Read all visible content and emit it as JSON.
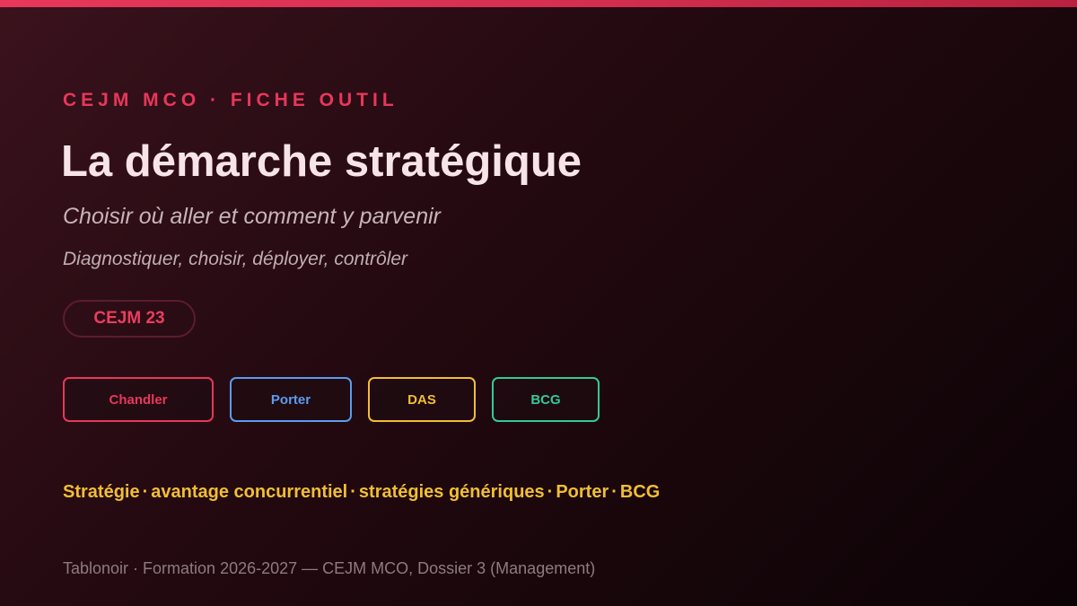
{
  "kicker": "CEJM MCO · FICHE OUTIL",
  "title": "La démarche stratégique",
  "subtitle": "Choisir où aller et comment y parvenir",
  "tagline": "Diagnostiquer, choisir, déployer, contrôler",
  "badge": "CEJM 23",
  "tools": [
    {
      "label": "Chandler",
      "color": "#e8375a"
    },
    {
      "label": "Porter",
      "color": "#5b9cf0"
    },
    {
      "label": "DAS",
      "color": "#f2be34"
    },
    {
      "label": "BCG",
      "color": "#34c99a"
    }
  ],
  "keywords": [
    "Stratégie",
    "avantage concurrentiel",
    "stratégies génériques",
    "Porter",
    "BCG"
  ],
  "keyword_separator": "·",
  "footer": "Tablonoir · Formation 2026-2027 — CEJM MCO, Dossier 3 (Management)",
  "colors": {
    "accent": "#e8375a",
    "keywords": "#f2be34",
    "title": "#f7e4ea"
  }
}
